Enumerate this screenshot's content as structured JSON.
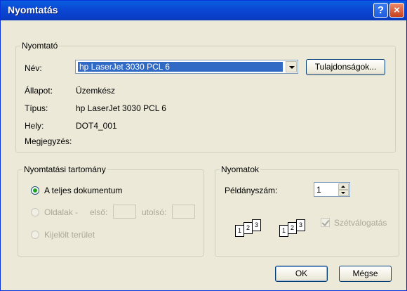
{
  "window": {
    "title": "Nyomtatás",
    "help_icon": "?",
    "close_icon": "×"
  },
  "printer_group": {
    "legend": "Nyomtató",
    "name_label": "Név:",
    "name_value": "hp LaserJet 3030 PCL 6",
    "properties_button": "Tulajdonságok...",
    "status_label": "Állapot:",
    "status_value": "Üzemkész",
    "type_label": "Típus:",
    "type_value": "hp LaserJet 3030 PCL 6",
    "location_label": "Hely:",
    "location_value": "DOT4_001",
    "comment_label": "Megjegyzés:"
  },
  "range_group": {
    "legend": "Nyomtatási tartomány",
    "all_label": "A teljes dokumentum",
    "pages_label": "Oldalak -",
    "from_label": "első:",
    "to_label": "utolsó:",
    "selection_label": "Kijelölt terület"
  },
  "copies_group": {
    "legend": "Nyomatok",
    "copies_label": "Példányszám:",
    "copies_value": "1",
    "collate_label": "Szétválogatás",
    "collate_checked": true,
    "stack_labels": [
      "1",
      "2",
      "3"
    ]
  },
  "footer": {
    "ok_label": "OK",
    "cancel_label": "Mégse"
  }
}
